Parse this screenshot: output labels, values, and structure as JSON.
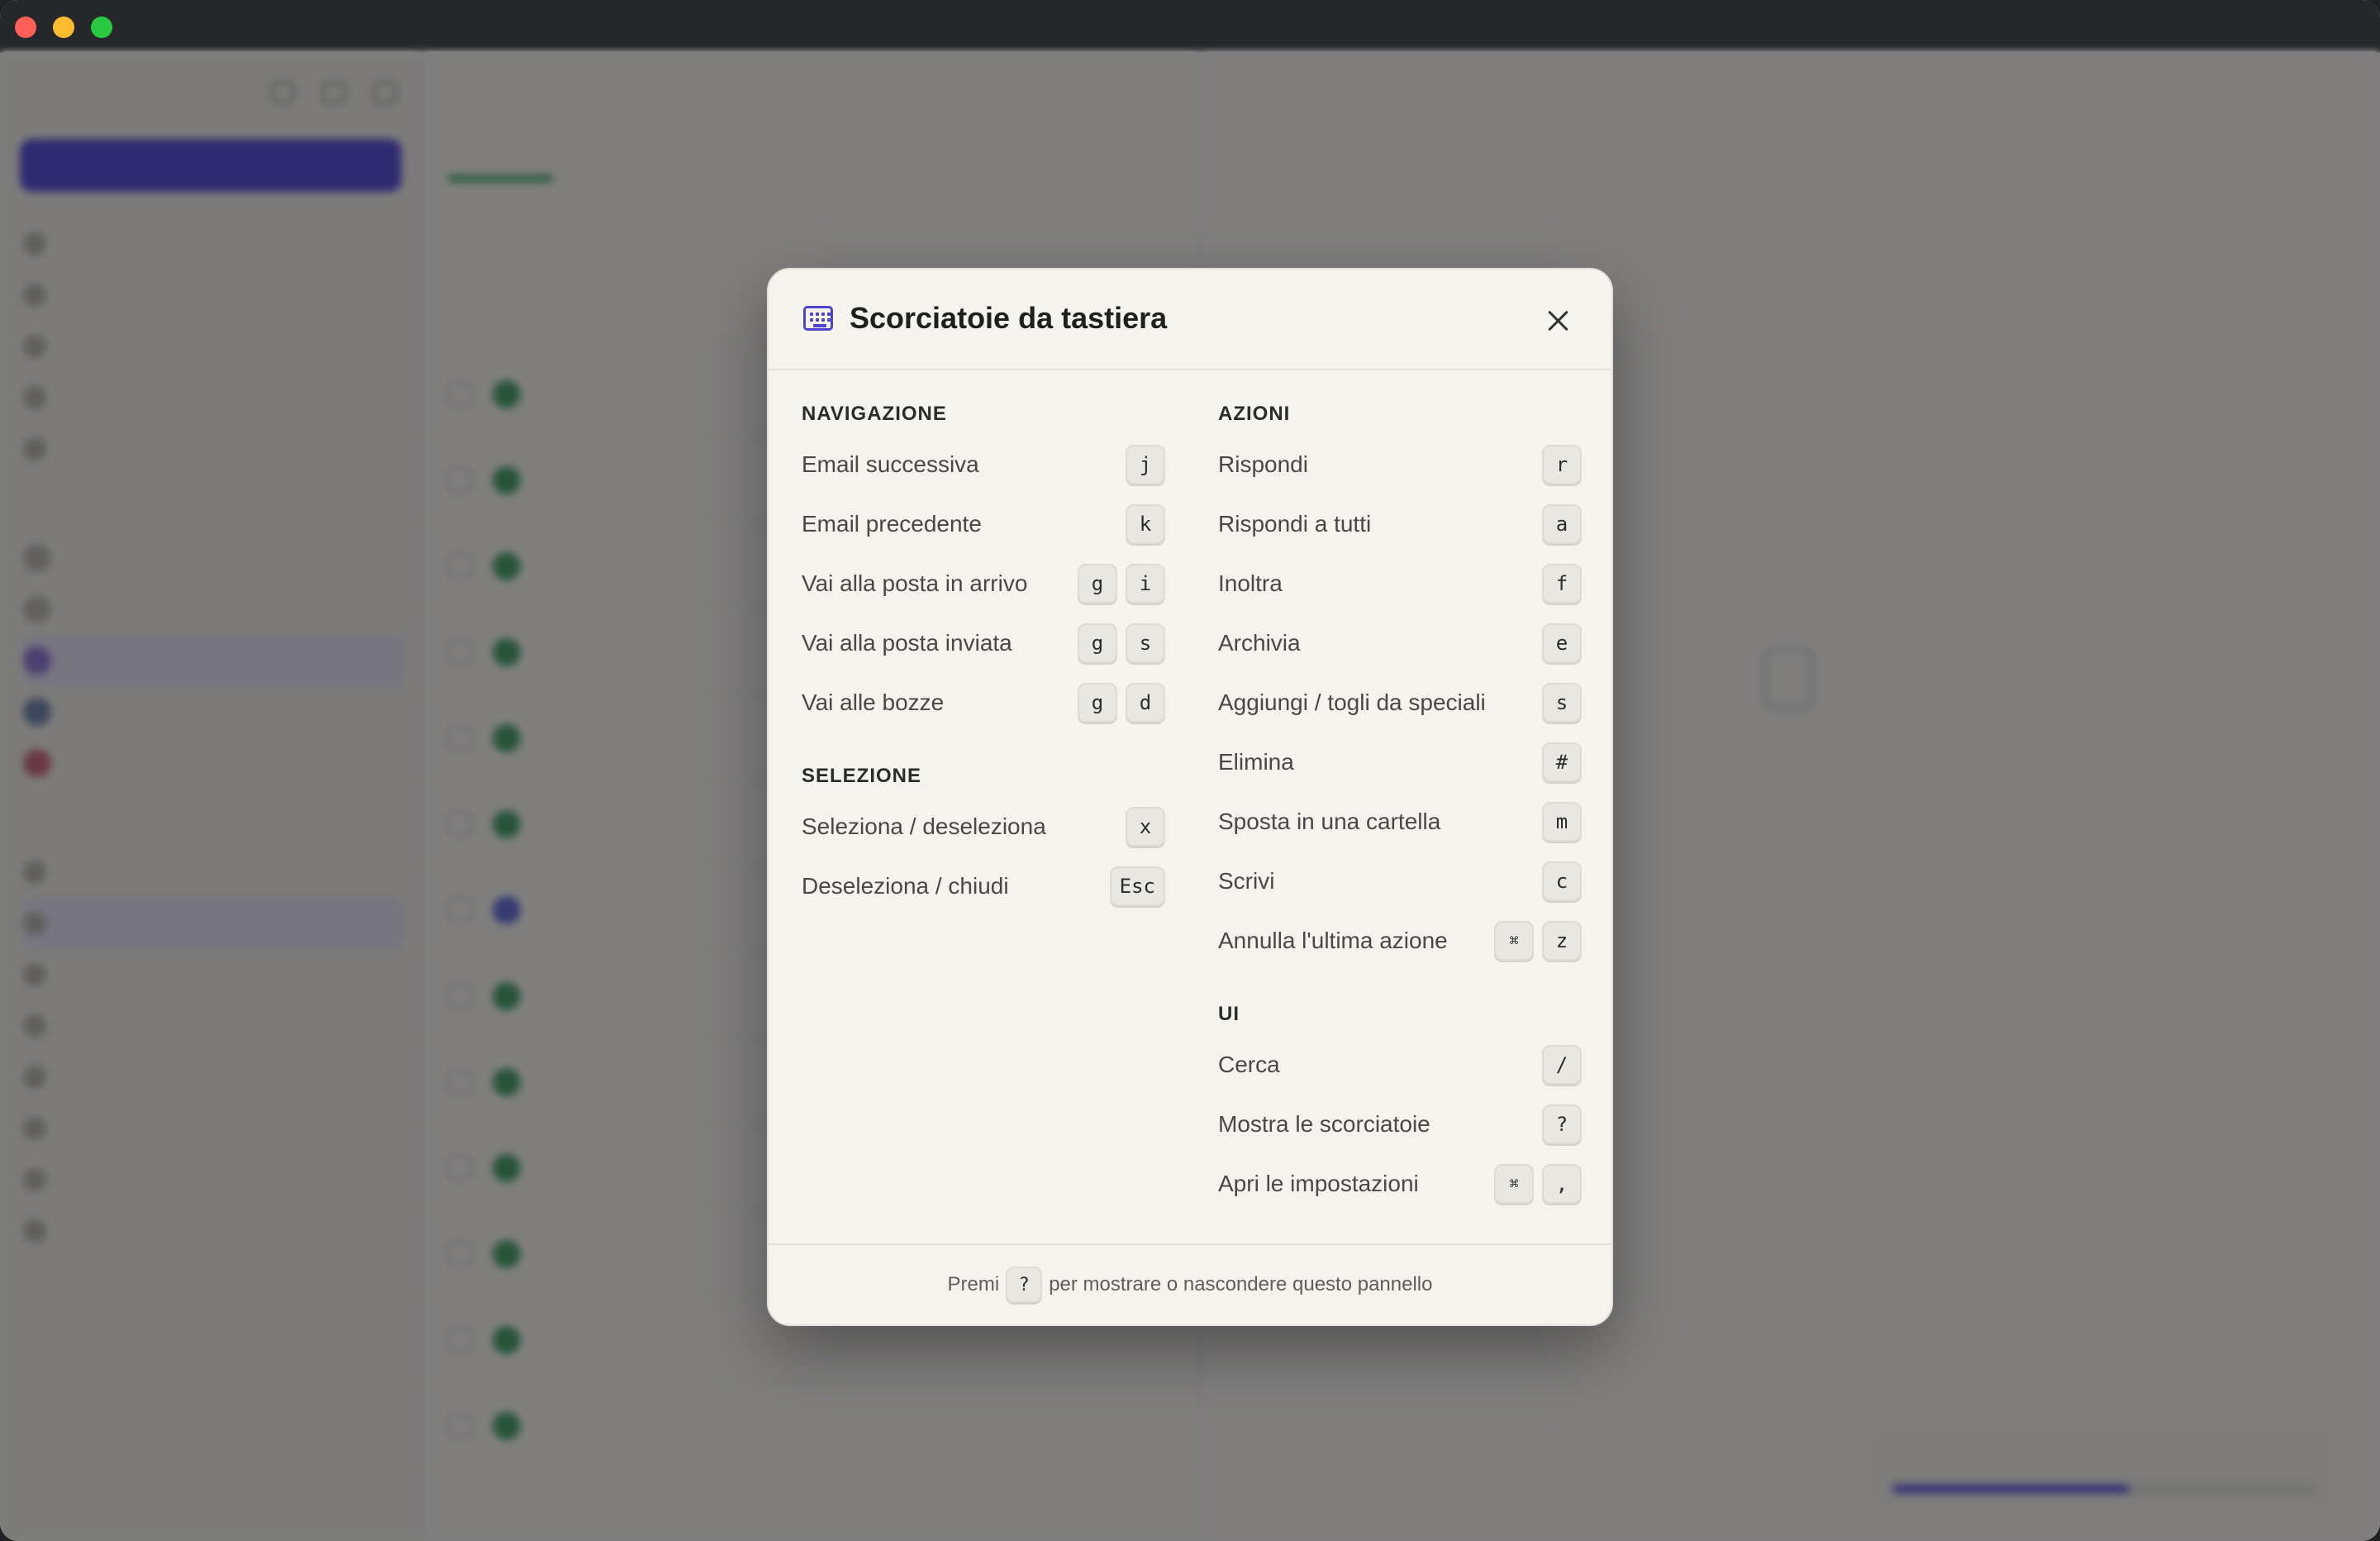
{
  "modal": {
    "title": "Scorciatoie da tastiera",
    "sections_left": [
      {
        "title": "NAVIGAZIONE",
        "items": [
          {
            "label": "Email successiva",
            "keys": [
              "j"
            ]
          },
          {
            "label": "Email precedente",
            "keys": [
              "k"
            ]
          },
          {
            "label": "Vai alla posta in arrivo",
            "keys": [
              "g",
              "i"
            ]
          },
          {
            "label": "Vai alla posta inviata",
            "keys": [
              "g",
              "s"
            ]
          },
          {
            "label": "Vai alle bozze",
            "keys": [
              "g",
              "d"
            ]
          }
        ]
      },
      {
        "title": "SELEZIONE",
        "items": [
          {
            "label": "Seleziona / deseleziona",
            "keys": [
              "x"
            ]
          },
          {
            "label": "Deseleziona / chiudi",
            "keys": [
              "Esc"
            ]
          }
        ]
      }
    ],
    "sections_right": [
      {
        "title": "AZIONI",
        "items": [
          {
            "label": "Rispondi",
            "keys": [
              "r"
            ]
          },
          {
            "label": "Rispondi a tutti",
            "keys": [
              "a"
            ]
          },
          {
            "label": "Inoltra",
            "keys": [
              "f"
            ]
          },
          {
            "label": "Archivia",
            "keys": [
              "e"
            ]
          },
          {
            "label": "Aggiungi / togli da speciali",
            "keys": [
              "s"
            ]
          },
          {
            "label": "Elimina",
            "keys": [
              "#"
            ]
          },
          {
            "label": "Sposta in una cartella",
            "keys": [
              "m"
            ]
          },
          {
            "label": "Scrivi",
            "keys": [
              "c"
            ]
          },
          {
            "label": "Annulla l'ultima azione",
            "keys": [
              "⌘",
              "z"
            ]
          }
        ]
      },
      {
        "title": "UI",
        "items": [
          {
            "label": "Cerca",
            "keys": [
              "/"
            ]
          },
          {
            "label": "Mostra le scorciatoie",
            "keys": [
              "?"
            ]
          },
          {
            "label": "Apri le impostazioni",
            "keys": [
              "⌘",
              ","
            ]
          }
        ]
      }
    ],
    "footer": {
      "prefix": "Premi",
      "key": "?",
      "suffix": "per mostrare o nascondere questo pannello"
    }
  },
  "colors": {
    "accent": "#4e43c9",
    "overlay": "#141416"
  },
  "icons": {
    "title_icon": "keyboard-icon",
    "close_icon": "close-icon"
  }
}
